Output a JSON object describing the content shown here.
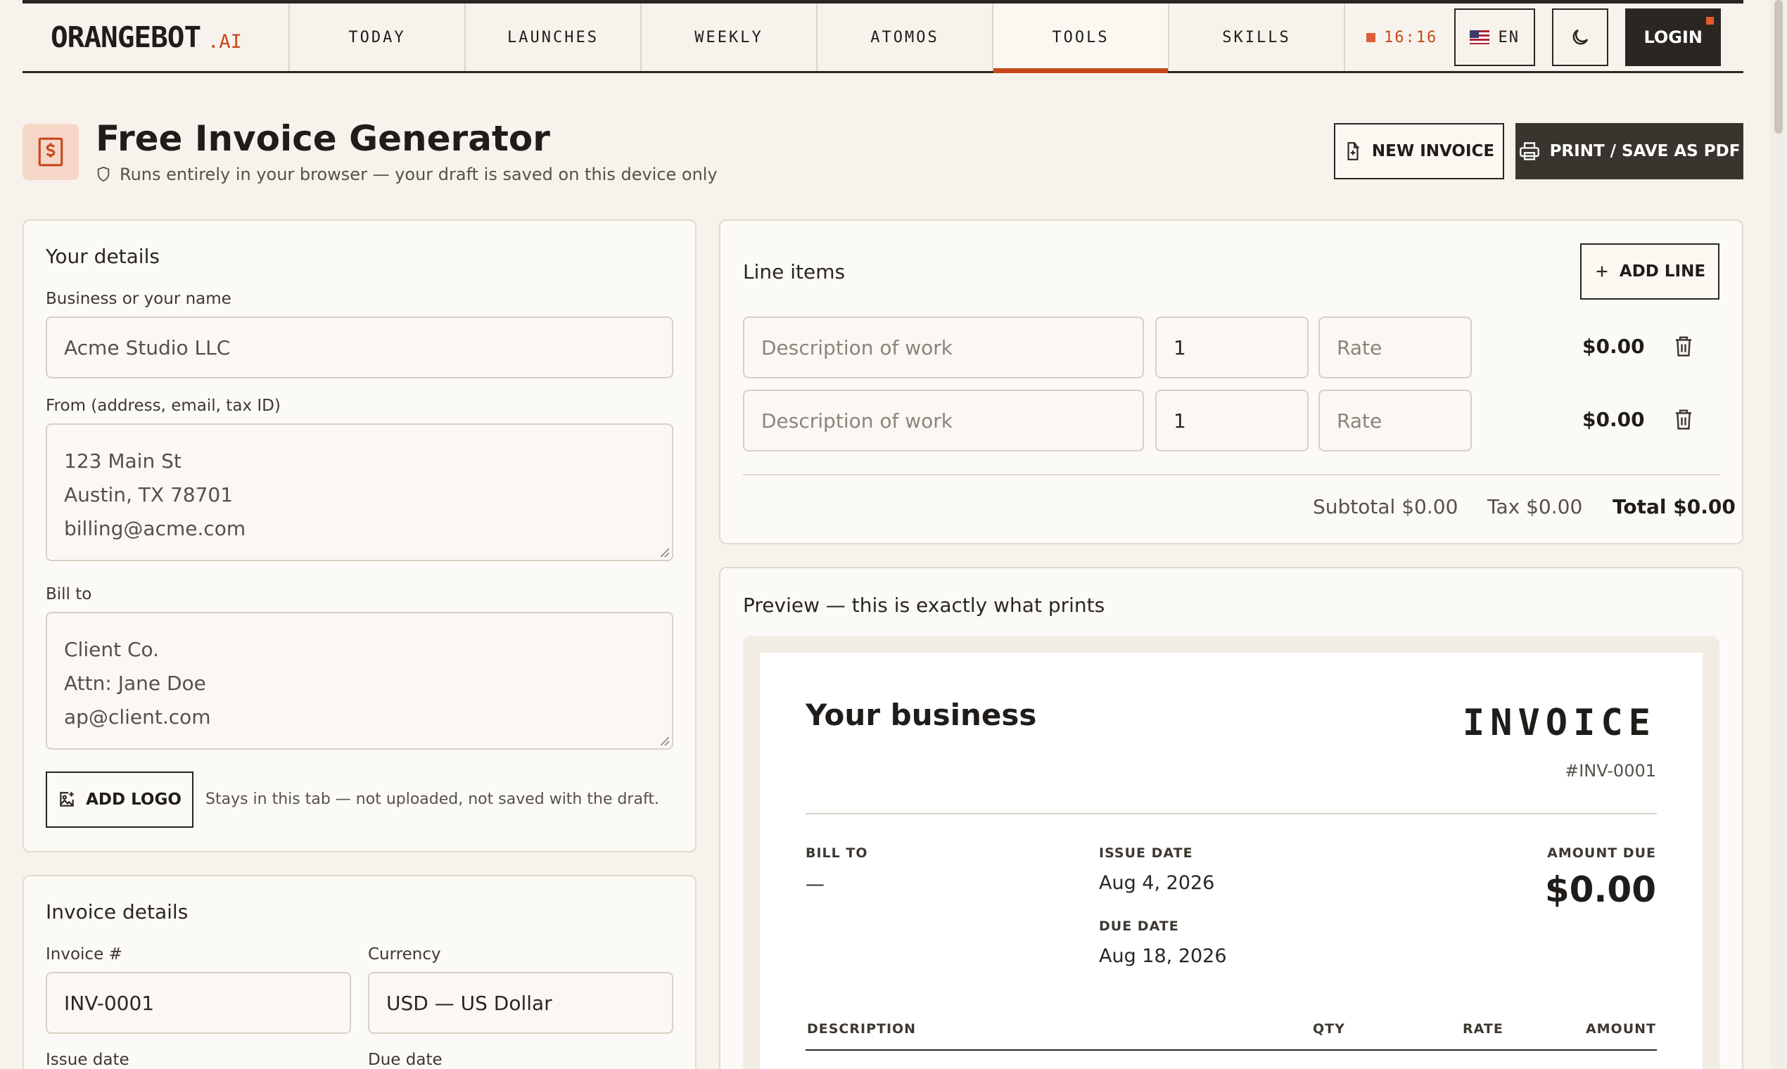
{
  "nav": {
    "brand": "ORANGEBOT",
    "brand_suffix": ".AI",
    "tabs": [
      {
        "label": "TODAY"
      },
      {
        "label": "LAUNCHES"
      },
      {
        "label": "WEEKLY"
      },
      {
        "label": "ATOMOS"
      },
      {
        "label": "TOOLS"
      },
      {
        "label": "SKILLS"
      }
    ],
    "active_tab": "TOOLS",
    "clock": "16:16",
    "language": "EN",
    "login": "LOGIN"
  },
  "header": {
    "title": "Free Invoice Generator",
    "subtitle": "Runs entirely in your browser — your draft is saved on this device only",
    "new_invoice": "NEW INVOICE",
    "print": "PRINT / SAVE AS PDF"
  },
  "your_details": {
    "title": "Your details",
    "business_label": "Business or your name",
    "business_placeholder": "Acme Studio LLC",
    "from_label": "From (address, email, tax ID)",
    "from_placeholder_lines": [
      "123 Main St",
      "Austin, TX 78701",
      "billing@acme.com"
    ],
    "bill_to_label": "Bill to",
    "bill_to_placeholder_lines": [
      "Client Co.",
      "Attn: Jane Doe",
      "ap@client.com"
    ],
    "add_logo": "ADD LOGO",
    "logo_note": "Stays in this tab — not uploaded, not saved with the draft."
  },
  "invoice_details": {
    "title": "Invoice details",
    "number_label": "Invoice #",
    "number_value": "INV-0001",
    "currency_label": "Currency",
    "currency_value": "USD — US Dollar",
    "issue_label": "Issue date",
    "due_label": "Due date"
  },
  "line_items": {
    "title": "Line items",
    "add_line": "ADD LINE",
    "rows": [
      {
        "desc_placeholder": "Description of work",
        "qty": "1",
        "rate_placeholder": "Rate",
        "amount": "$0.00"
      },
      {
        "desc_placeholder": "Description of work",
        "qty": "1",
        "rate_placeholder": "Rate",
        "amount": "$0.00"
      }
    ],
    "subtotal": "Subtotal $0.00",
    "tax": "Tax $0.00",
    "total": "Total $0.00"
  },
  "preview": {
    "title": "Preview — this is exactly what prints",
    "business": "Your business",
    "heading": "INVOICE",
    "number": "#INV-0001",
    "bill_to_label": "BILL TO",
    "bill_to_value": "—",
    "issue_label": "ISSUE DATE",
    "issue_value": "Aug 4, 2026",
    "due_label": "DUE DATE",
    "due_value": "Aug 18, 2026",
    "amount_due_label": "AMOUNT DUE",
    "amount_due_value": "$0.00",
    "columns": [
      "DESCRIPTION",
      "QTY",
      "RATE",
      "AMOUNT"
    ]
  },
  "colors": {
    "accent": "#c8471f",
    "dark": "#2a2622",
    "background": "#f7f3ec"
  }
}
